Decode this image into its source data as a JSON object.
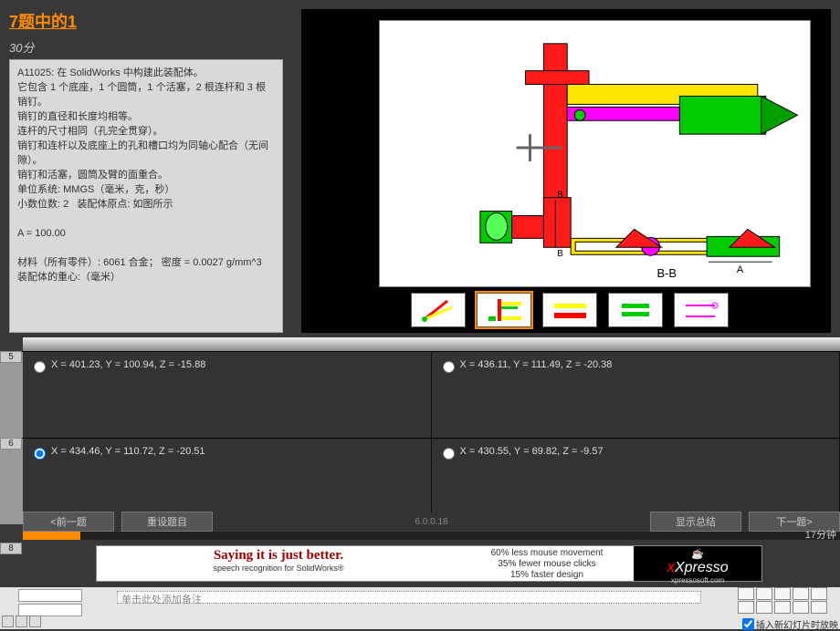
{
  "header": {
    "question_title": "7题中的1",
    "score": "30分"
  },
  "problem": {
    "lines": [
      "A11025: 在 SolidWorks 中构建此装配体。",
      "它包含 1 个底座，1 个圆筒，1 个活塞，2 根连杆和 3 根销钉。",
      "销钉的直径和长度均相等。",
      "连杆的尺寸相同（孔完全贯穿）。",
      "销钉和连杆以及底座上的孔和槽口均为同轴心配合（无间隙）。",
      "销钉和活塞，圆筒及臂的面重合。",
      "单位系统: MMGS（毫米，克，秒）",
      "小数位数: 2   装配体原点: 如图所示",
      "",
      "A = 100.00",
      "",
      "材料（所有零件）: 6061 合金； 密度 = 0.0027 g/mm^3",
      "装配体的重心:（毫米）"
    ]
  },
  "diagram": {
    "section_label": "B-B",
    "dim_A": "A",
    "dim_B": "B"
  },
  "answers": [
    {
      "num": "5",
      "options": [
        {
          "id": "a",
          "text": "X = 401.23, Y = 100.94, Z = -15.88"
        },
        {
          "id": "b",
          "text": "X = 436.11, Y = 111.49, Z = -20.38"
        }
      ]
    },
    {
      "num": "6",
      "options": [
        {
          "id": "c",
          "text": "X = 434.46, Y = 110.72, Z = -20.51",
          "checked": true
        },
        {
          "id": "d",
          "text": "X = 430.55, Y = 69.82, Z = -9.57"
        }
      ]
    }
  ],
  "buttons": {
    "prev": "<前一题",
    "reset": "重设题目",
    "summary": "显示总结",
    "next": "下一题>"
  },
  "version": "6.0.0.18",
  "timer": "17分钟",
  "ad": {
    "big": "Saying it is just better.",
    "small": "speech recognition for SolidWorks®",
    "mid1": "60% less mouse movement",
    "mid2": "35% fewer mouse clicks",
    "mid3": "15% faster design",
    "brand": "Xpresso",
    "url": "xpressosoft.com"
  },
  "powerpoint": {
    "note_placeholder": "单击此处添加备注",
    "slideshow_check": "插入新幻灯片时放映"
  }
}
